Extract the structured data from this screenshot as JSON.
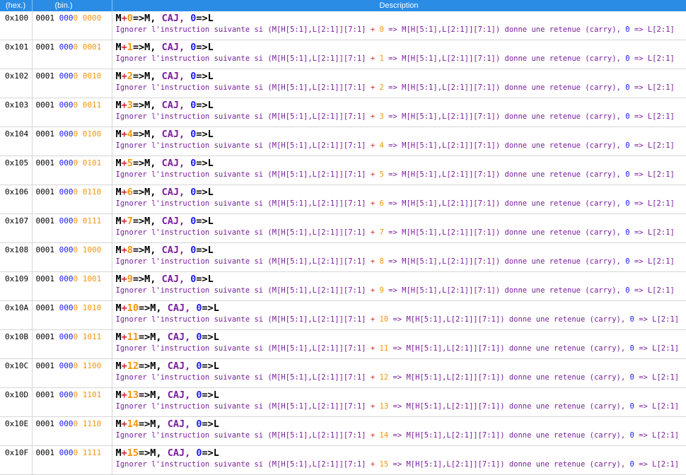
{
  "headers": {
    "hex": "(hex.)",
    "bin": "(bin.)",
    "desc": "Description"
  },
  "text": {
    "op_prefix": "M",
    "plus": "+",
    "arrow_m": "=>M,",
    "caj": "CAJ,",
    "zero": "0",
    "arrow_l": "=>L",
    "detail_a": "Ignorer l'instruction suivante si (M[H[5:1],L[2:1]][7:1]",
    "detail_b": "=> M[H[5:1],L[2:1]][7:1]) donne une retenue (carry),",
    "detail_c": "=> L[2:1]"
  },
  "rows": [
    {
      "hex": "0x100",
      "bin1": "0001",
      "bin2a": "000",
      "bin2b": "0",
      "bin3": "0000",
      "n": "0"
    },
    {
      "hex": "0x101",
      "bin1": "0001",
      "bin2a": "000",
      "bin2b": "0",
      "bin3": "0001",
      "n": "1"
    },
    {
      "hex": "0x102",
      "bin1": "0001",
      "bin2a": "000",
      "bin2b": "0",
      "bin3": "0010",
      "n": "2"
    },
    {
      "hex": "0x103",
      "bin1": "0001",
      "bin2a": "000",
      "bin2b": "0",
      "bin3": "0011",
      "n": "3"
    },
    {
      "hex": "0x104",
      "bin1": "0001",
      "bin2a": "000",
      "bin2b": "0",
      "bin3": "0100",
      "n": "4"
    },
    {
      "hex": "0x105",
      "bin1": "0001",
      "bin2a": "000",
      "bin2b": "0",
      "bin3": "0101",
      "n": "5"
    },
    {
      "hex": "0x106",
      "bin1": "0001",
      "bin2a": "000",
      "bin2b": "0",
      "bin3": "0110",
      "n": "6"
    },
    {
      "hex": "0x107",
      "bin1": "0001",
      "bin2a": "000",
      "bin2b": "0",
      "bin3": "0111",
      "n": "7"
    },
    {
      "hex": "0x108",
      "bin1": "0001",
      "bin2a": "000",
      "bin2b": "0",
      "bin3": "1000",
      "n": "8"
    },
    {
      "hex": "0x109",
      "bin1": "0001",
      "bin2a": "000",
      "bin2b": "0",
      "bin3": "1001",
      "n": "9"
    },
    {
      "hex": "0x10A",
      "bin1": "0001",
      "bin2a": "000",
      "bin2b": "0",
      "bin3": "1010",
      "n": "10"
    },
    {
      "hex": "0x10B",
      "bin1": "0001",
      "bin2a": "000",
      "bin2b": "0",
      "bin3": "1011",
      "n": "11"
    },
    {
      "hex": "0x10C",
      "bin1": "0001",
      "bin2a": "000",
      "bin2b": "0",
      "bin3": "1100",
      "n": "12"
    },
    {
      "hex": "0x10D",
      "bin1": "0001",
      "bin2a": "000",
      "bin2b": "0",
      "bin3": "1101",
      "n": "13"
    },
    {
      "hex": "0x10E",
      "bin1": "0001",
      "bin2a": "000",
      "bin2b": "0",
      "bin3": "1110",
      "n": "14"
    },
    {
      "hex": "0x10F",
      "bin1": "0001",
      "bin2a": "000",
      "bin2b": "0",
      "bin3": "1111",
      "n": "15"
    }
  ],
  "colors": {
    "header_bg": "#2b8ce6",
    "blue": "#1a1aff",
    "orange": "#f2950c",
    "purple": "#7a1e9c",
    "red": "#d4292e"
  }
}
